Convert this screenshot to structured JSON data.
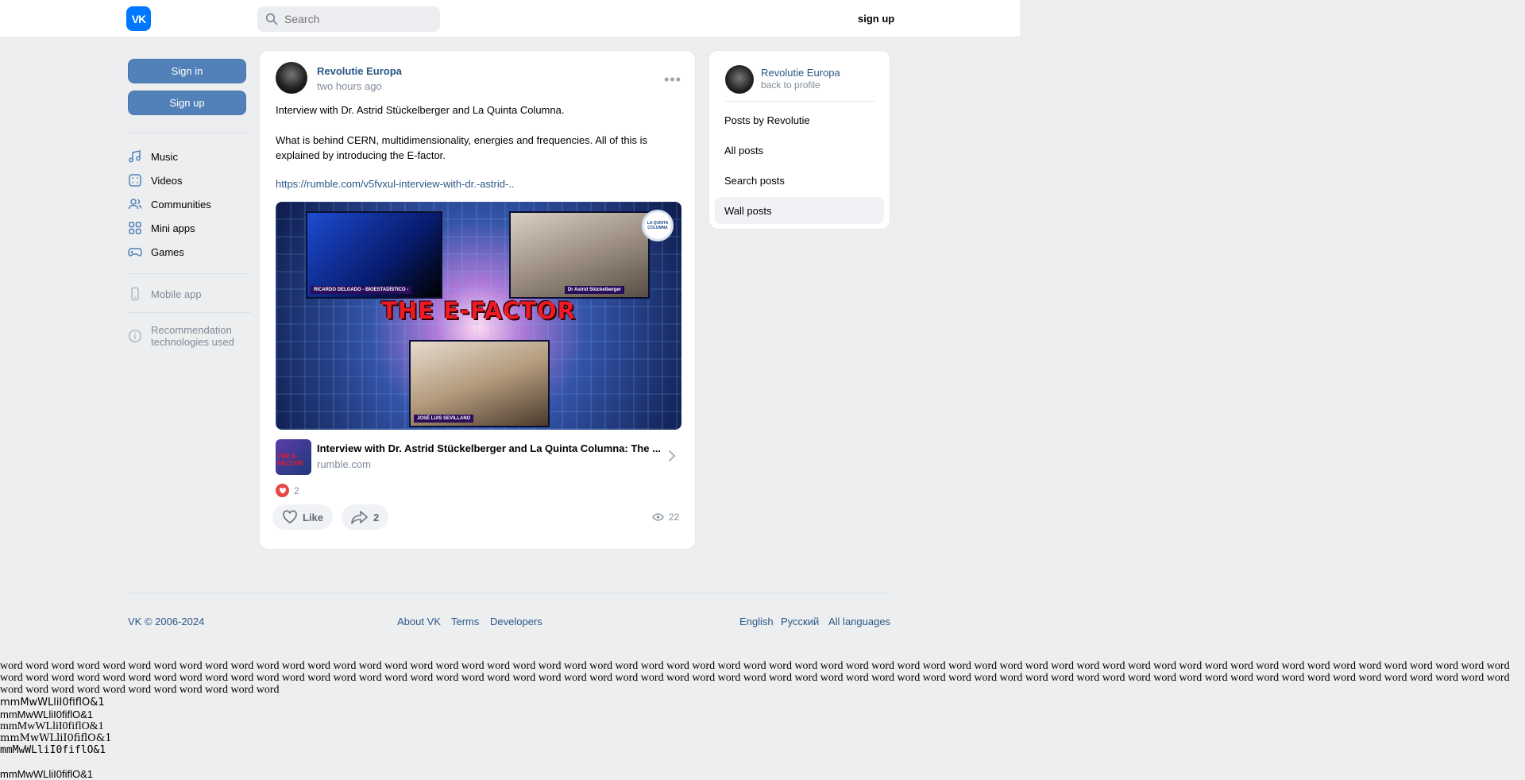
{
  "header": {
    "logo_text": "VK",
    "search_placeholder": "Search",
    "signup_label": "sign up"
  },
  "sidebar": {
    "signin_label": "Sign in",
    "signup_label": "Sign up",
    "items": [
      {
        "label": "Music",
        "icon": "music-icon"
      },
      {
        "label": "Videos",
        "icon": "video-icon"
      },
      {
        "label": "Communities",
        "icon": "communities-icon"
      },
      {
        "label": "Mini apps",
        "icon": "mini-apps-icon"
      },
      {
        "label": "Games",
        "icon": "gamepad-icon"
      }
    ],
    "mobile_app": "Mobile app",
    "recommendation_line1": "Recommendation",
    "recommendation_line2": "technologies used"
  },
  "post": {
    "author": "Revolutie Europa",
    "time": "two hours ago",
    "paragraph1": "Interview with Dr. Astrid Stückelberger and La Quinta Columna.",
    "paragraph2": "What is behind CERN, multidimensionality, energies and frequencies. All of this is explained by introducing the E-factor.",
    "link": "https://rumble.com/v5fvxul-interview-with-dr.-astrid-..",
    "media": {
      "headline": "THE E-FACTOR",
      "caption1": "RICARDO DELGADO - BIOESTADÍSTICO -",
      "caption2": "Dr Astrid Stückelberger",
      "caption3": "JOSÉ LUIS SEVILLANO",
      "badge": "LA QUINTA COLUMNA"
    },
    "link_card": {
      "title": "Interview with Dr. Astrid Stückelberger and La Quinta Columna: The ...",
      "domain": "rumble.com",
      "thumb_text": "THE E-FACTOR"
    },
    "reactions_count": "2",
    "like_label": "Like",
    "share_count": "2",
    "views": "22"
  },
  "right_panel": {
    "name": "Revolutie Europa",
    "back": "back to profile",
    "items": [
      "Posts by Revolutie",
      "All posts",
      "Search posts",
      "Wall posts"
    ],
    "active_index": 3
  },
  "footer": {
    "copyright": "VK © 2006-2024",
    "about": "About VK",
    "terms": "Terms",
    "developers": "Developers",
    "english": "English",
    "russian": "Русский",
    "all_languages": "All languages"
  },
  "measure": {
    "words_line": "word word word word word word word word word word word word word word word word word word word word word word word word word word word word word word word word word word word word word word word word word word word word word word word word word word word word word word word word word word word word word word word word word word word word word word word word word word word word word word word word word word word word word word word word word word word word word word word word word word word word word word word word word word word word word word word word word word word word word word word word word word word word word word word word word",
    "sample1": "mmMwWLliI0fiflO&1",
    "sample2": "mmMwWLliI0fiflO&1",
    "sample3": "mmMwWLliI0fiflO&1",
    "sample4": "mmMwWLliI0fiflO&1",
    "sample5": "mmMwWLliI0fiflO&1",
    "sample6": "mmMwWLliI0fiflO&1"
  }
}
